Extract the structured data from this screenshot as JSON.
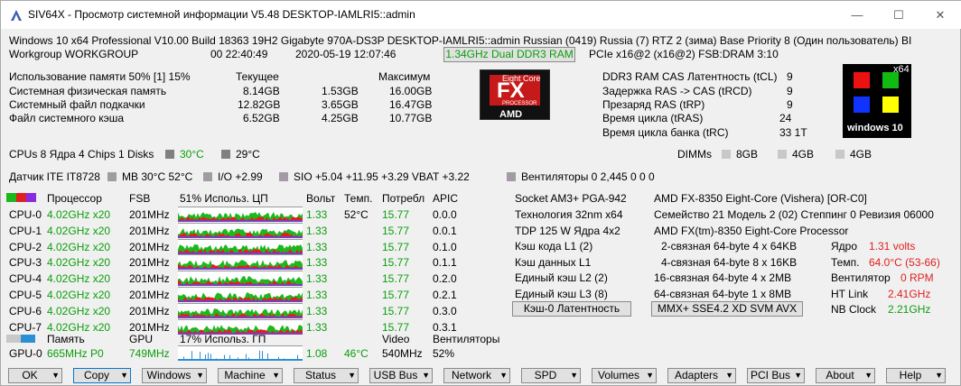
{
  "title": {
    "text": "SIV64X - Просмотр системной информации V5.48 DESKTOP-IAMLRI5::admin",
    "minimize": "—",
    "maximize": "☐",
    "close": "✕"
  },
  "sys": {
    "r1": "Windows 10 x64 Professional  V10.00  Build 18363  19H2  Gigabyte 970A-DS3P  DESKTOP-IAMLRI5::admin  Russian (0419)  Russia (7)  RTZ 2 (зима)  Base Priority 8 (Один пользователь)  BI",
    "r2a": "Workgroup WORKGROUP",
    "r2b": "00 22:40:49",
    "r2c": "2020-05-19 12:07:46",
    "r2d": "1.34GHz Dual DDR3 RAM",
    "r2e": "PCIe x16@2 (x16@2) FSB:DRAM 3:10"
  },
  "mem": {
    "h": [
      "Использование памяти 50% [1] 15%",
      "Текущее",
      "Максимум"
    ],
    "rows": [
      [
        "Системная физическая память",
        "8.14GB",
        "1.53GB",
        "16.00GB"
      ],
      [
        "Системный файл подкачки",
        "12.82GB",
        "3.65GB",
        "16.47GB"
      ],
      [
        "Файл системного кэша",
        "6.52GB",
        "4.25GB",
        "10.77GB"
      ]
    ]
  },
  "fxlogo": {
    "top": "Eight Core",
    "main": "FX",
    "sub": "PROCESSOR",
    "amd": "AMD"
  },
  "ram": {
    "rows": [
      [
        "DDR3 RAM CAS Латентность (tCL)",
        "9"
      ],
      [
        "Задержка RAS -> CAS (tRCD)",
        "9"
      ],
      [
        "Презаряд RAS (tRP)",
        "9"
      ],
      [
        "Время цикла (tRAS)",
        "24"
      ],
      [
        "Время цикла банка (tRC)",
        "33 1T"
      ]
    ]
  },
  "winlogo": {
    "x64": "x64",
    "label": "windows 10"
  },
  "cpuline": {
    "text": "CPUs 8 Ядра 4 Chips 1  Disks",
    "t1": "30°C",
    "t2": "29°C"
  },
  "dimms": {
    "label": "DIMMs",
    "v": [
      "8GB",
      "4GB",
      "4GB"
    ]
  },
  "sensor": {
    "a": "Датчик ITE IT8728",
    "b": "MB 30°C 52°C",
    "c": "I/O +2.99",
    "d": "SIO +5.04 +11.95 +3.29 VBAT +3.22",
    "e": "Вентиляторы 0 2,445 0 0 0"
  },
  "cpuhead": [
    "Процессор",
    "FSB",
    "51% Использ. ЦП",
    "Вольт",
    "Темп.",
    "Потребл",
    "APIC"
  ],
  "cpus": [
    {
      "n": "CPU-0",
      "f": "4.02GHz x20",
      "fsb": "201MHz",
      "v": "1.33",
      "t": "52°C",
      "p": "15.77",
      "a": "0.0.0"
    },
    {
      "n": "CPU-1",
      "f": "4.02GHz x20",
      "fsb": "201MHz",
      "v": "1.33",
      "t": "",
      "p": "15.77",
      "a": "0.0.1"
    },
    {
      "n": "CPU-2",
      "f": "4.02GHz x20",
      "fsb": "201MHz",
      "v": "1.33",
      "t": "",
      "p": "15.77",
      "a": "0.1.0"
    },
    {
      "n": "CPU-3",
      "f": "4.02GHz x20",
      "fsb": "201MHz",
      "v": "1.33",
      "t": "",
      "p": "15.77",
      "a": "0.1.1"
    },
    {
      "n": "CPU-4",
      "f": "4.02GHz x20",
      "fsb": "201MHz",
      "v": "1.33",
      "t": "",
      "p": "15.77",
      "a": "0.2.0"
    },
    {
      "n": "CPU-5",
      "f": "4.02GHz x20",
      "fsb": "201MHz",
      "v": "1.33",
      "t": "",
      "p": "15.77",
      "a": "0.2.1"
    },
    {
      "n": "CPU-6",
      "f": "4.02GHz x20",
      "fsb": "201MHz",
      "v": "1.33",
      "t": "",
      "p": "15.77",
      "a": "0.3.0"
    },
    {
      "n": "CPU-7",
      "f": "4.02GHz x20",
      "fsb": "201MHz",
      "v": "1.33",
      "t": "",
      "p": "15.77",
      "a": "0.3.1"
    }
  ],
  "gpuhead": [
    "Память",
    "GPU",
    "17% Использ. ГП",
    "Video",
    "Вентиляторы"
  ],
  "gpu": {
    "n": "GPU-0",
    "mem": "665MHz P0",
    "clk": "749MHz",
    "v": "1.08",
    "t": "46°C",
    "video": "540MHz",
    "fan": "52%"
  },
  "proc": {
    "l": [
      "Socket AM3+ PGA-942",
      "Технология 32nm  x64",
      "TDP 125 W Ядра 4x2",
      "Кэш кода L1 (2)",
      "Кэш данных L1",
      "Единый кэш L2 (2)",
      "Единый кэш L3 (8)"
    ],
    "r": [
      "AMD FX-8350 Eight-Core (Vishera) [OR-C0]",
      "Семейство 21  Модель 2 (02)  Степпинг 0  Ревизия 06000",
      "AMD FX(tm)-8350 Eight-Core Processor",
      "2-связная 64-byte  4 x 64KB",
      "4-связная 64-byte  8 x 16KB",
      "16-связная 64-byte  4 x 2MB",
      "64-связная 64-byte  1 x 8MB"
    ],
    "btn1": "Кэш-0 Латентность",
    "btn2": "MMX+ SSE4.2 XD SVM AVX"
  },
  "stats": [
    [
      "Ядро",
      "1.31 volts"
    ],
    [
      "Темп.",
      "64.0°C (53-66)"
    ],
    [
      "Вентилятор",
      "0 RPM"
    ],
    [
      "HT Link",
      "2.41GHz"
    ],
    [
      "NB Clock",
      "2.21GHz"
    ]
  ],
  "menu": [
    "OK",
    "Copy",
    "Windows",
    "Machine",
    "Status",
    "USB Bus",
    "Network",
    "SPD",
    "Volumes",
    "Adapters",
    "PCI Bus",
    "About",
    "Help"
  ],
  "colors": {
    "green": "#0a9e0a",
    "red": "#e02020",
    "accent": "#0078d7"
  }
}
